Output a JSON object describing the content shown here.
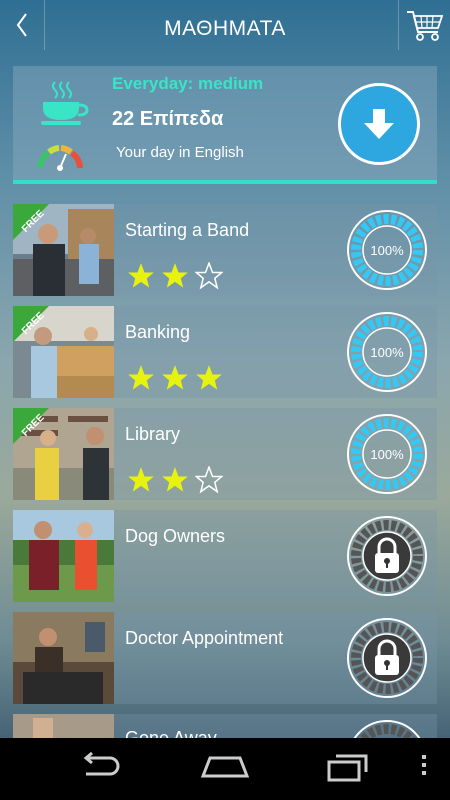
{
  "header": {
    "title": "ΜΑΘΗΜΑΤΑ"
  },
  "course": {
    "level": "Everyday: medium",
    "levels_count": "22 Επίπεδα",
    "subtitle": "Your day in English"
  },
  "lessons": [
    {
      "title": "Starting a Band",
      "free_label": "FREE",
      "stars": 2,
      "progress": "100%",
      "locked": false
    },
    {
      "title": "Banking",
      "free_label": "FREE",
      "stars": 3,
      "progress": "100%",
      "locked": false
    },
    {
      "title": "Library",
      "free_label": "FREE",
      "stars": 2,
      "progress": "100%",
      "locked": false
    },
    {
      "title": "Dog Owners",
      "free_label": "",
      "stars": 0,
      "progress": "",
      "locked": true
    },
    {
      "title": "Doctor Appointment",
      "free_label": "",
      "stars": 0,
      "progress": "",
      "locked": true
    },
    {
      "title": "Gone Away",
      "free_label": "",
      "stars": 0,
      "progress": "",
      "locked": true
    }
  ],
  "colors": {
    "accent": "#39e5c6",
    "progress": "#33c8f5",
    "star": "#e7f20f",
    "download": "#2ea6e0"
  },
  "icons": {
    "back": "back-chevron-icon",
    "cart": "shopping-cart-icon",
    "cup": "coffee-cup-icon",
    "gauge": "gauge-icon",
    "download": "download-arrow-icon",
    "lock": "padlock-icon"
  }
}
